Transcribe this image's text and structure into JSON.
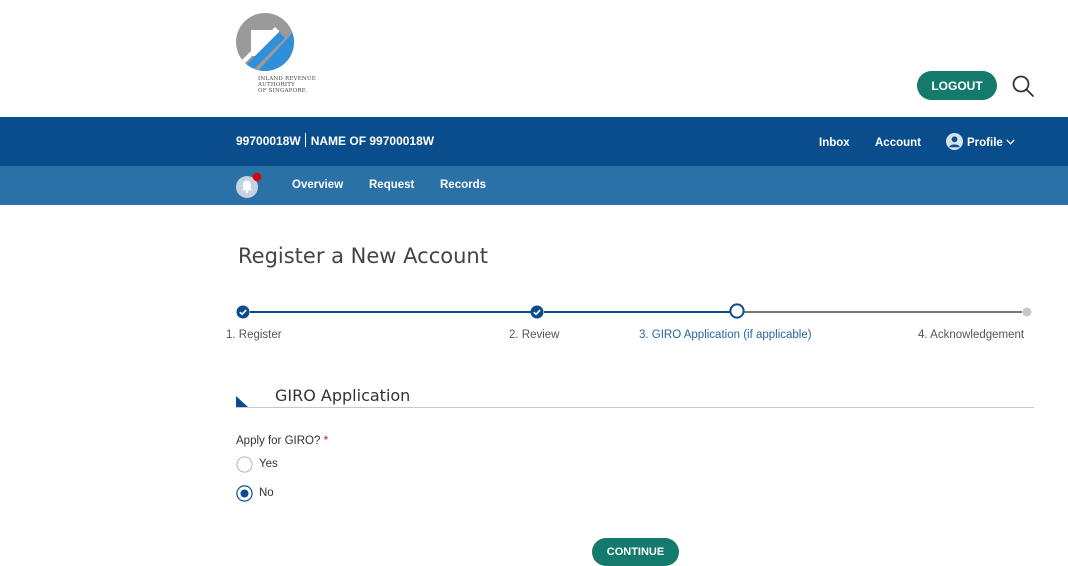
{
  "brand": {
    "logo_icon": "iras-logo-icon",
    "org_name_lines": [
      "INLAND REVENUE",
      "AUTHORITY",
      "OF SINGAPORE"
    ]
  },
  "header": {
    "logout_label": "LOGOUT",
    "search_icon": "search-icon"
  },
  "account_bar": {
    "account_id": "99700018W",
    "account_name": "NAME OF 99700018W",
    "nav": {
      "inbox": "Inbox",
      "account": "Account",
      "profile": "Profile"
    },
    "profile_icon": "avatar-icon",
    "dropdown_icon": "chevron-down-icon"
  },
  "sub_nav": {
    "bell_icon": "bell-icon",
    "has_notification": true,
    "items": [
      "Overview",
      "Request",
      "Records"
    ]
  },
  "page": {
    "title": "Register a New Account"
  },
  "stepper": {
    "steps": [
      {
        "label": "1. Register",
        "state": "completed"
      },
      {
        "label": "2. Review",
        "state": "completed"
      },
      {
        "label": "3. GIRO Application (if applicable)",
        "state": "current"
      },
      {
        "label": "4. Acknowledgement",
        "state": "pending"
      }
    ]
  },
  "section": {
    "title": "GIRO Application"
  },
  "giro_question": {
    "label": "Apply for GIRO?",
    "required_marker": "*",
    "options": [
      {
        "label": "Yes",
        "selected": false
      },
      {
        "label": "No",
        "selected": true
      }
    ]
  },
  "actions": {
    "continue_label": "CONTINUE"
  },
  "colors": {
    "primary_navy": "#0a4d8c",
    "secondary_blue": "#2a71a8",
    "button_teal": "#147a6b",
    "required_red": "#c8102e",
    "notification_red": "#e00000"
  }
}
